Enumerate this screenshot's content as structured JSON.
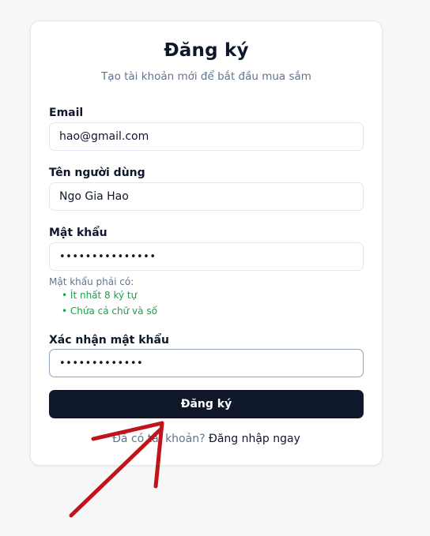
{
  "form": {
    "title": "Đăng ký",
    "subtitle": "Tạo tài khoản mới để bắt đầu mua sắm",
    "email": {
      "label": "Email",
      "value": "hao@gmail.com"
    },
    "username": {
      "label": "Tên người dùng",
      "value": "Ngo Gia Hao"
    },
    "password": {
      "label": "Mật khẩu",
      "value": "•••••••••••••••"
    },
    "password_hint": {
      "title": "Mật khẩu phải có:",
      "rules": [
        "Ít nhất 8 ký tự",
        "Chứa cả chữ và số"
      ]
    },
    "confirm_password": {
      "label": "Xác nhận mật khẩu",
      "value": "•••••••••••••"
    },
    "submit_label": "Đăng ký",
    "footer": {
      "prompt": "Đã có tài khoản?",
      "login_link": "Đăng nhập ngay"
    }
  },
  "colors": {
    "primary": "#0f172a",
    "muted": "#64748b",
    "success": "#16a34a",
    "annotation_arrow": "#c0141c"
  },
  "annotation": {
    "icon": "red-arrow-icon"
  }
}
